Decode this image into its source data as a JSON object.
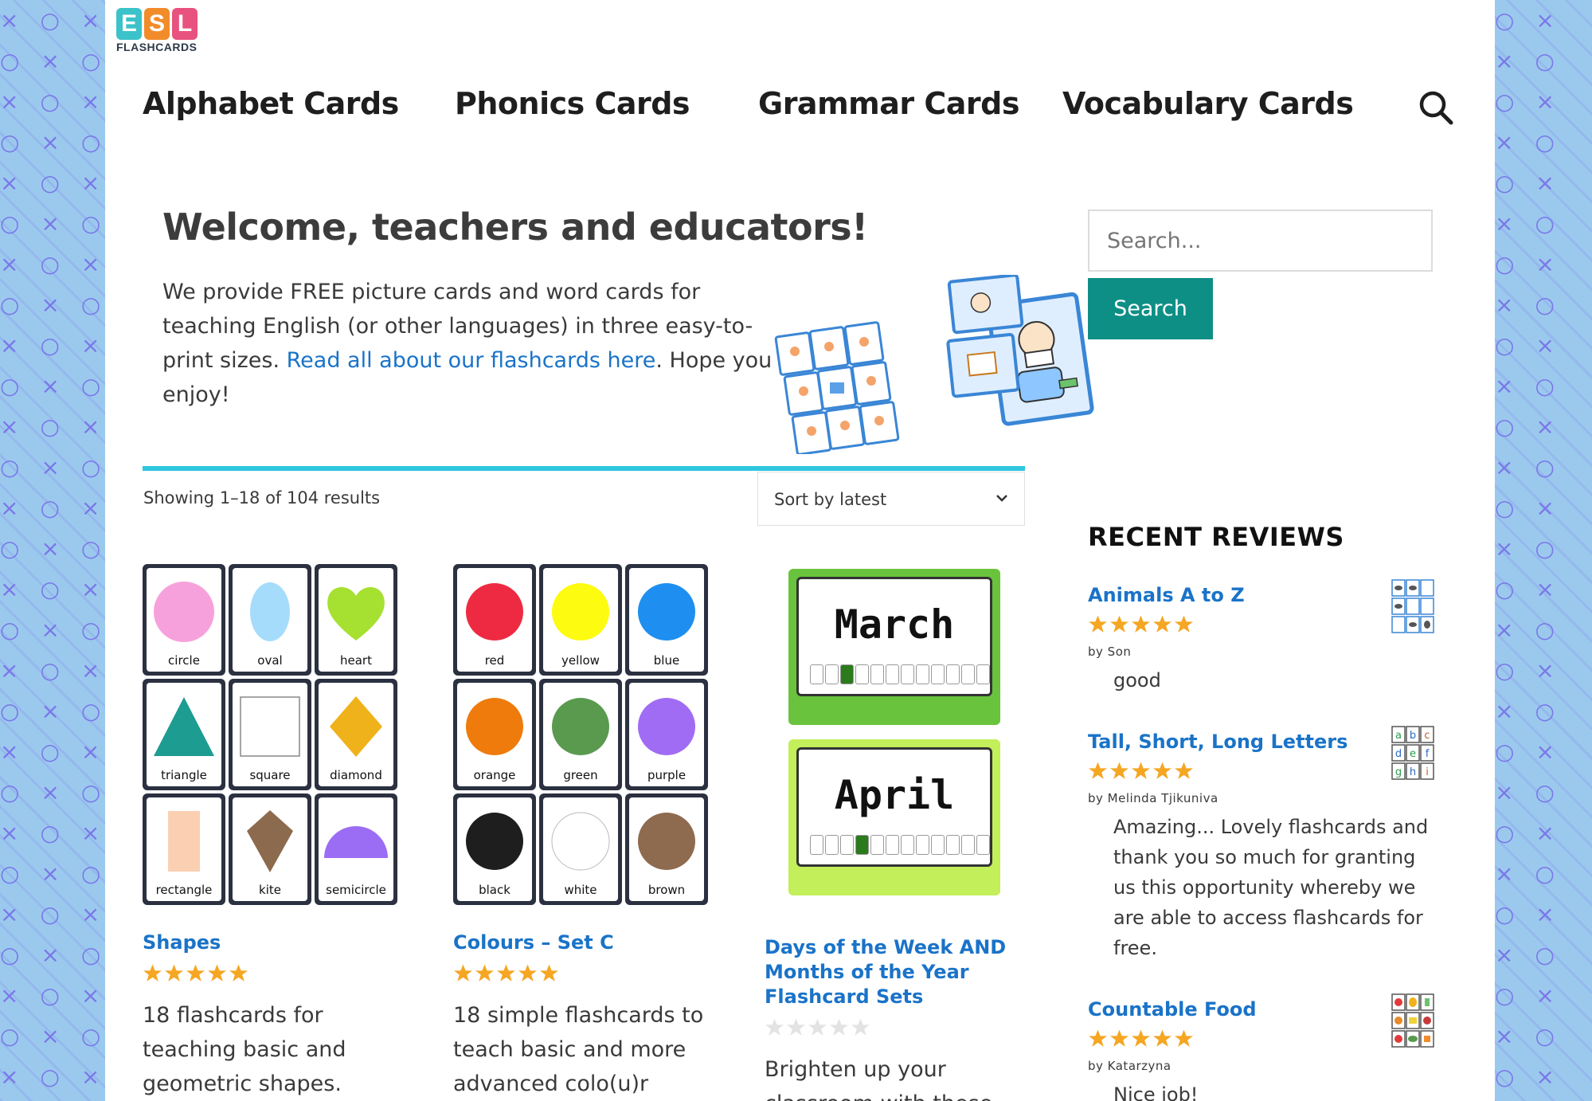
{
  "logo": {
    "letters": [
      "E",
      "S",
      "L"
    ],
    "letter_colors": [
      "#3cc2c9",
      "#f28c2a",
      "#e8527f"
    ],
    "subtitle": "FLASHCARDS"
  },
  "nav": {
    "items": [
      "Alphabet Cards",
      "Phonics Cards",
      "Grammar Cards",
      "Vocabulary Cards"
    ],
    "search_icon": "search-icon"
  },
  "welcome": {
    "title": "Welcome, teachers and educators!",
    "text_before": "We provide FREE picture cards and word cards for teaching English (or other languages) in three easy-to-print sizes.",
    "link_text": "Read all about our flashcards here",
    "text_after": ". Hope you enjoy!"
  },
  "shop": {
    "results": "Showing 1–18 of 104 results",
    "sort_label": "Sort by latest",
    "products": [
      {
        "title": "Shapes",
        "rating": 5,
        "description": "18 flashcards for teaching basic and geometric shapes.",
        "cards": [
          "circle",
          "oval",
          "heart",
          "triangle",
          "square",
          "diamond",
          "rectangle",
          "kite",
          "semicircle"
        ]
      },
      {
        "title": "Colours – Set C",
        "rating": 5,
        "description": "18 simple flashcards to teach basic and more advanced colo(u)r",
        "cards": [
          "red",
          "yellow",
          "blue",
          "orange",
          "green",
          "purple",
          "black",
          "white",
          "brown"
        ],
        "card_colors": [
          "#ee2a43",
          "#fdfb0f",
          "#1e8ff0",
          "#ee7b0c",
          "#5a9a4f",
          "#a06cf4",
          "#1e1e1e",
          "#ffffff",
          "#8e6a4f"
        ]
      },
      {
        "title": "Days of the Week AND Months of the Year Flashcard Sets",
        "rating": 0,
        "description": "Brighten up your classroom with these",
        "months": [
          "March",
          "April"
        ],
        "month_positions": [
          3,
          4
        ]
      }
    ]
  },
  "sidebar": {
    "search_placeholder": "Search...",
    "search_button": "Search",
    "reviews_heading": "RECENT REVIEWS",
    "reviews": [
      {
        "title": "Animals A to Z",
        "rating": 5,
        "by": "by Son",
        "text": "good"
      },
      {
        "title": "Tall, Short, Long Letters",
        "rating": 5,
        "by": "by Melinda Tjikuniva",
        "text": "Amazing... Lovely flashcards and thank you so much for granting us this opportunity whereby we are able to access flashcards for free."
      },
      {
        "title": "Countable Food",
        "rating": 5,
        "by": "by Katarzyna",
        "text": "Nice job!"
      }
    ]
  },
  "colors": {
    "accent_teal": "#0e8f86",
    "link_blue": "#1a73c8",
    "rule_cyan": "#2fc6e0",
    "star_gold": "#f5a623"
  }
}
